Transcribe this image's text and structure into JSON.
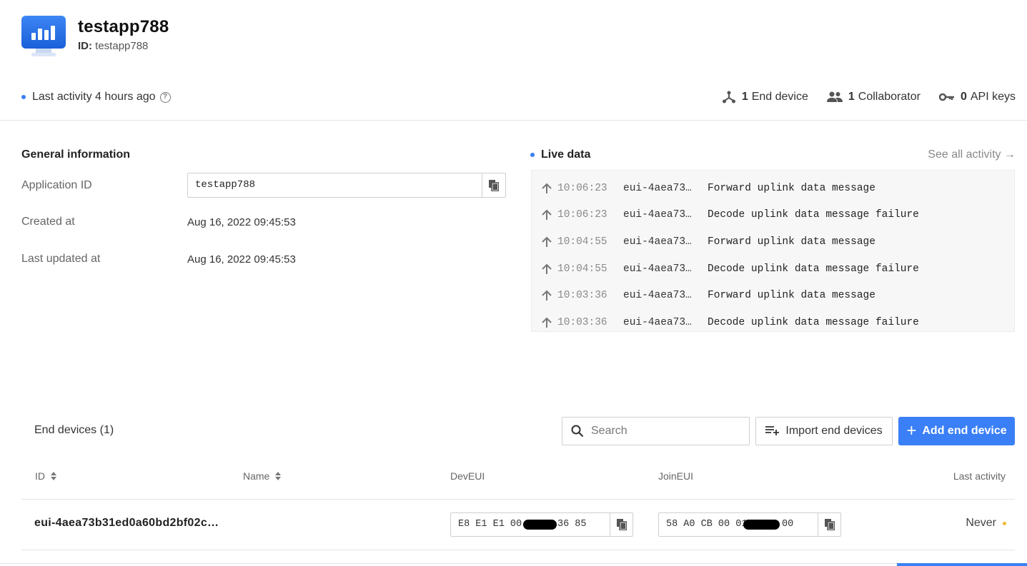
{
  "app": {
    "title": "testapp788",
    "id_label": "ID:",
    "id_value": "testapp788"
  },
  "status": {
    "last_activity": "Last activity 4 hours ago",
    "end_device_count": "1",
    "end_device_label": "End device",
    "collaborator_count": "1",
    "collaborator_label": "Collaborator",
    "api_key_count": "0",
    "api_key_label": "API keys"
  },
  "general": {
    "title": "General information",
    "application_id_label": "Application ID",
    "application_id_value": "testapp788",
    "created_label": "Created at",
    "created_value": "Aug 16, 2022 09:45:53",
    "updated_label": "Last updated at",
    "updated_value": "Aug 16, 2022 09:45:53"
  },
  "live": {
    "title": "Live data",
    "see_all": "See all activity →",
    "events": [
      {
        "time": "10:06:23",
        "device": "eui-4aea73…",
        "message": "Forward uplink data message"
      },
      {
        "time": "10:06:23",
        "device": "eui-4aea73…",
        "message": "Decode uplink data message failure"
      },
      {
        "time": "10:04:55",
        "device": "eui-4aea73…",
        "message": "Forward uplink data message"
      },
      {
        "time": "10:04:55",
        "device": "eui-4aea73…",
        "message": "Decode uplink data message failure"
      },
      {
        "time": "10:03:36",
        "device": "eui-4aea73…",
        "message": "Forward uplink data message"
      },
      {
        "time": "10:03:36",
        "device": "eui-4aea73…",
        "message": "Decode uplink data message failure"
      }
    ]
  },
  "devices": {
    "title": "End devices (1)",
    "search_placeholder": "Search",
    "import_label": "Import end devices",
    "add_label": "Add end device",
    "columns": {
      "id": "ID",
      "name": "Name",
      "dev_eui": "DevEUI",
      "join_eui": "JoinEUI",
      "last_activity": "Last activity"
    },
    "rows": [
      {
        "id": "eui-4aea73b31ed0a60bd2bf02c…",
        "dev_eui_start": "E8 E1 E1 00",
        "dev_eui_end": "36 85",
        "join_eui_start": "58 A0 CB 00 01",
        "join_eui_end": "00",
        "last_activity": "Never"
      }
    ]
  },
  "colors": {
    "accent": "#3a7ff6",
    "status_idle": "#f2b93b"
  }
}
